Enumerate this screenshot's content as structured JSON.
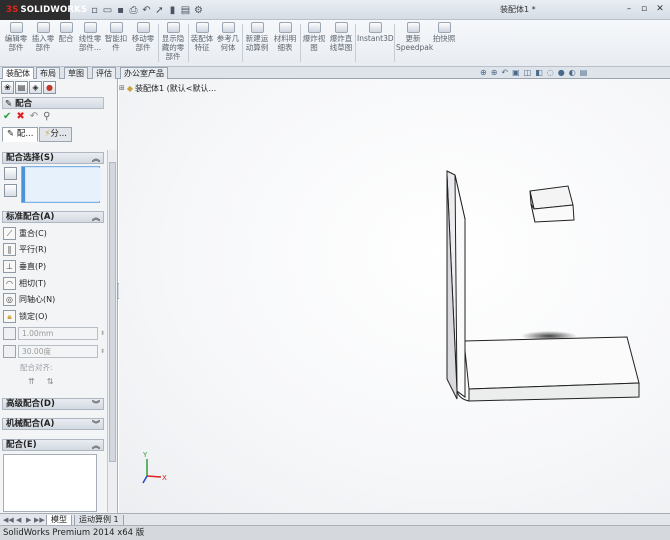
{
  "app": {
    "logo_text": "SOLIDWORKS",
    "doc_title": "装配体1 *"
  },
  "ribbon": {
    "buttons": [
      {
        "label": "编辑零\n部件"
      },
      {
        "label": "插入零\n部件"
      },
      {
        "label": "配合"
      },
      {
        "label": "线性零\n部件..."
      },
      {
        "label": "智能扣\n件"
      },
      {
        "label": "移动零\n部件"
      },
      {
        "label": "显示隐\n藏的零\n部件"
      },
      {
        "label": "装配体\n特征"
      },
      {
        "label": "参考几\n何体"
      },
      {
        "label": "新建运\n动算例"
      },
      {
        "label": "材料明\n细表"
      },
      {
        "label": "爆炸视\n图"
      },
      {
        "label": "爆炸直\n线草图"
      },
      {
        "label": "Instant3D"
      },
      {
        "label": "更新\nSpeedpak"
      },
      {
        "label": "拍快照"
      }
    ]
  },
  "command_tabs": [
    {
      "label": "装配体"
    },
    {
      "label": "布局"
    },
    {
      "label": "草图"
    },
    {
      "label": "评估"
    },
    {
      "label": "办公室产品"
    }
  ],
  "property_manager": {
    "title": "配合",
    "tabs": [
      {
        "label": "配..."
      },
      {
        "label": "分..."
      }
    ],
    "mate_selections": {
      "header": "配合选择(S)"
    },
    "standard_mates": {
      "header": "标准配合(A)",
      "items": [
        {
          "label": "重合(C)",
          "icon": "coincident-icon"
        },
        {
          "label": "平行(R)",
          "icon": "parallel-icon"
        },
        {
          "label": "垂直(P)",
          "icon": "perpendicular-icon"
        },
        {
          "label": "相切(T)",
          "icon": "tangent-icon"
        },
        {
          "label": "同轴心(N)",
          "icon": "concentric-icon"
        },
        {
          "label": "锁定(O)",
          "icon": "lock-icon"
        }
      ],
      "distance_value": "1.00mm",
      "angle_value": "30.00度",
      "config_label": "配合对齐:"
    },
    "advanced_mates": {
      "header": "高级配合(D)"
    },
    "mechanical_mates": {
      "header": "机械配合(A)"
    },
    "mates": {
      "header": "配合(E)"
    }
  },
  "feature_tree": {
    "root_label": "装配体1 (默认<默认..."
  },
  "bottom_tabs": [
    {
      "label": "模型"
    },
    {
      "label": "运动算例 1"
    }
  ],
  "status_bar": {
    "text": "SolidWorks Premium 2014 x64 版"
  },
  "triad": {
    "x_label": "X",
    "y_label": "Y"
  }
}
